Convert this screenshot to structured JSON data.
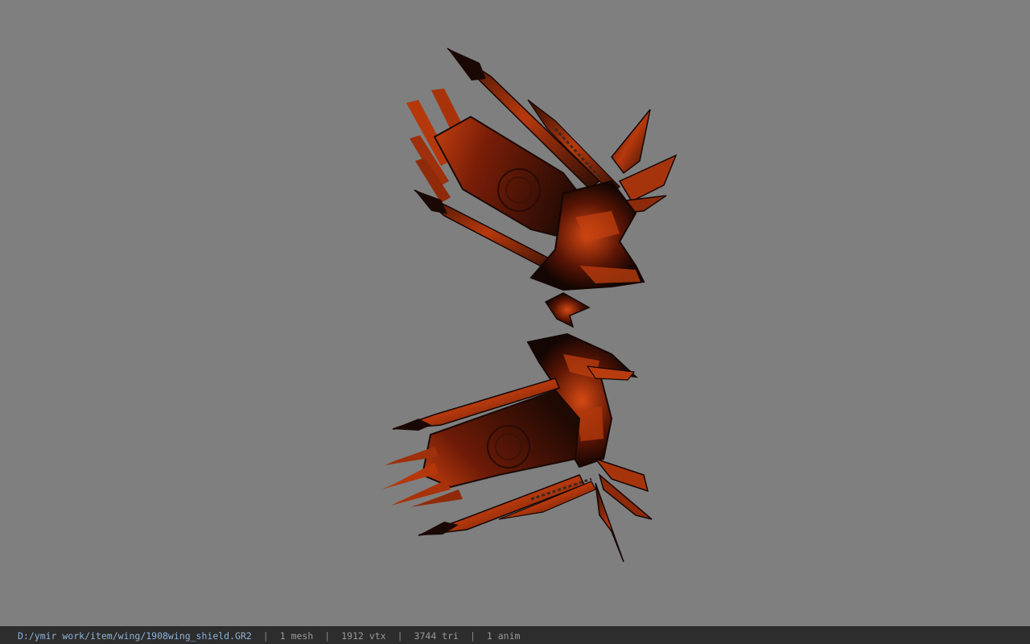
{
  "viewer": {
    "background_color": "#7f7f7f",
    "model_colors": {
      "dark": "#1a0a06",
      "mid": "#7a1e08",
      "bright": "#d0420f"
    }
  },
  "status_bar": {
    "file_path": "D:/ymir work/item/wing/1908wing_shield.GR2",
    "separator": "|",
    "mesh_count": "1 mesh",
    "vertex_count": "1912 vtx",
    "triangle_count": "3744 tri",
    "anim_count": "1 anim"
  }
}
